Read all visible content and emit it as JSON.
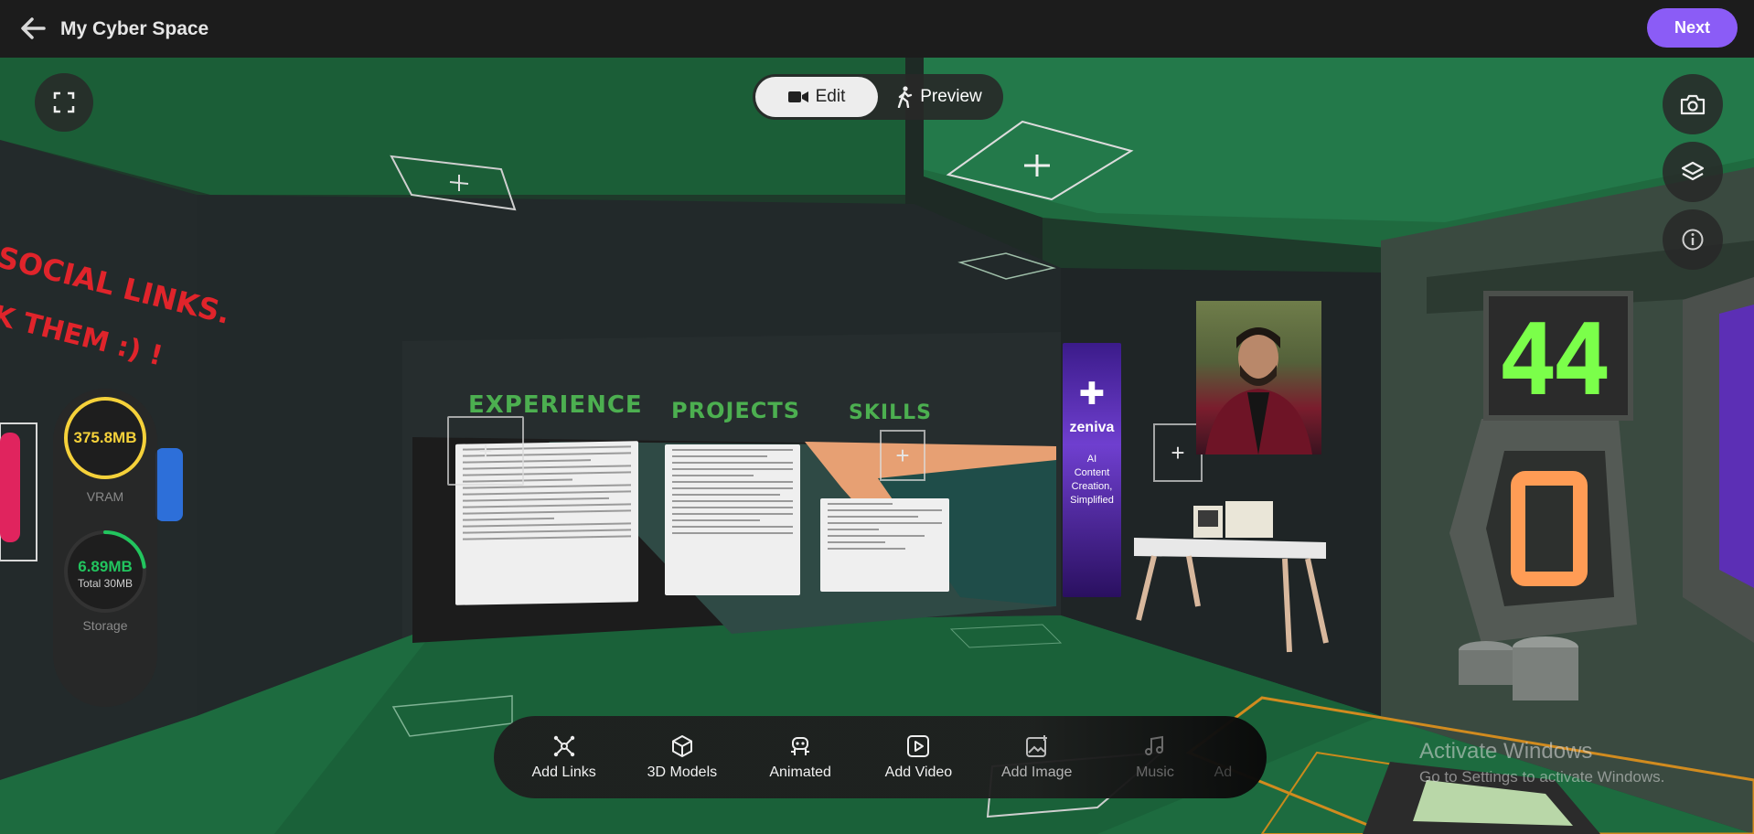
{
  "header": {
    "title": "My Cyber Space",
    "next_label": "Next"
  },
  "mode_toggle": {
    "edit_label": "Edit",
    "preview_label": "Preview",
    "active": "Edit"
  },
  "meters": {
    "vram": {
      "value": "375.8MB",
      "label": "VRAM",
      "color": "#f5d13a"
    },
    "storage": {
      "value": "6.89MB",
      "total": "Total 30MB",
      "label": "Storage",
      "color": "#22c55e",
      "fraction": 0.23
    }
  },
  "toolbar": {
    "items": [
      {
        "label": "Add Links",
        "icon": "links-icon"
      },
      {
        "label": "3D Models",
        "icon": "cube-icon"
      },
      {
        "label": "Animated",
        "icon": "robot-icon"
      },
      {
        "label": "Add Video",
        "icon": "video-icon"
      },
      {
        "label": "Add Image",
        "icon": "image-add-icon"
      },
      {
        "label": "Music",
        "icon": "music-icon"
      },
      {
        "label": "Ad",
        "icon": ""
      }
    ]
  },
  "scene": {
    "wall_words": [
      "EXPERIENCE",
      "PROJECTS",
      "SKILLS"
    ],
    "red_text_line1": "SOCIAL LINKS.",
    "red_text_line2": "K THEM :) !",
    "banner_brand": "zeniva",
    "banner_tagline": "AI Content Creation, Simplified",
    "scoreboard_value": "44"
  },
  "watermark": {
    "line1": "Activate Windows",
    "line2": "Go to Settings to activate Windows."
  }
}
